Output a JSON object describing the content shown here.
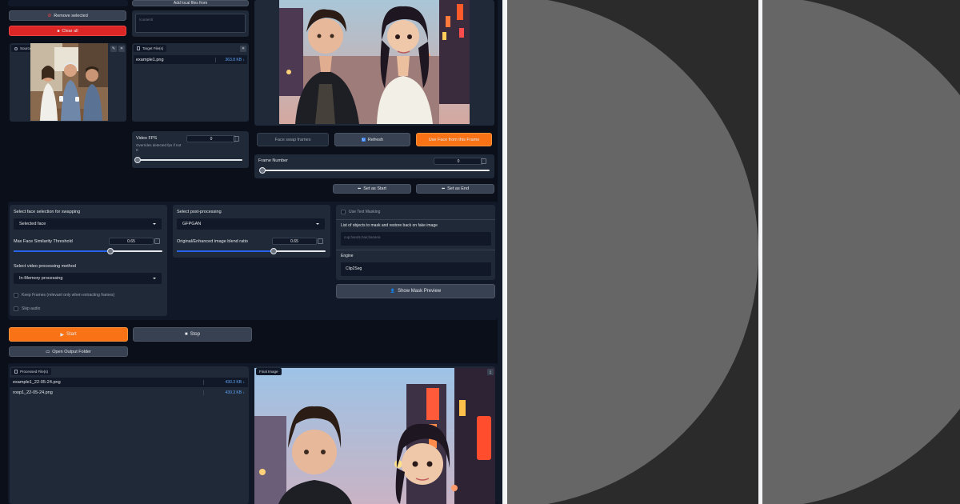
{
  "left_panel": {
    "remove_selected": "Remove selected",
    "clear_all": "Clear all",
    "source_tab": "Source Face Image"
  },
  "targets": {
    "add_local": "Add local files from",
    "content_placeholder": "/content/",
    "target_tab": "Target File(s)",
    "files": [
      {
        "name": "example1.png",
        "size": "363.8 KB ↓"
      }
    ]
  },
  "video": {
    "fps_label": "Video FPS",
    "fps_sub": "Overrides detected fps if not",
    "fps_sub2": "0",
    "fps_value": "0"
  },
  "frames": {
    "face_swap": "Face swap frames",
    "refresh": "Refresh",
    "use_face": "Use Face from this Frame",
    "frame_number_label": "Frame Number",
    "frame_number": "0",
    "set_start": "Set as Start",
    "set_end": "Set as End"
  },
  "settings": {
    "face_sel_label": "Select face selection for swapping",
    "face_sel_value": "Selected face",
    "similarity_label": "Max Face Similarity Threshold",
    "similarity_value": "0.65",
    "similarity_level": 0.65,
    "method_label": "Select video processing method",
    "method_value": "In-Memory processing",
    "keep_frames": "Keep Frames (relevant only when extracting frames)",
    "skip_audio": "Skip audio",
    "post_label": "Select post-processing",
    "post_value": "GFPGAN",
    "blend_label": "Original/Enhanced image blend ratio",
    "blend_value": "0.65",
    "blend_level": 0.65,
    "text_masking": "Use Text Masking",
    "mask_objects_label": "List of objects to mask and restore back on fake image",
    "mask_objects_placeholder": "cup,hands,hair,banana",
    "engine_label": "Engine",
    "engine_value": "Clip2Seg",
    "show_mask": "Show Mask Preview"
  },
  "actions": {
    "start": "Start",
    "stop": "Stop",
    "open_output": "Open Output Folder"
  },
  "output": {
    "processed_tab": "Processed File(s)",
    "final_tab": "Final Image",
    "files": [
      {
        "name": "example1_22-05-24.png",
        "size": "430.3 KB ↓"
      },
      {
        "name": "roop1_22-05-24.png",
        "size": "430.3 KB ↓"
      }
    ]
  },
  "colors": {
    "accent_orange": "#f97316",
    "danger_red": "#dc2626",
    "slider_blue": "#2563eb",
    "panel": "#1f2937",
    "bg": "#0b0f19"
  }
}
